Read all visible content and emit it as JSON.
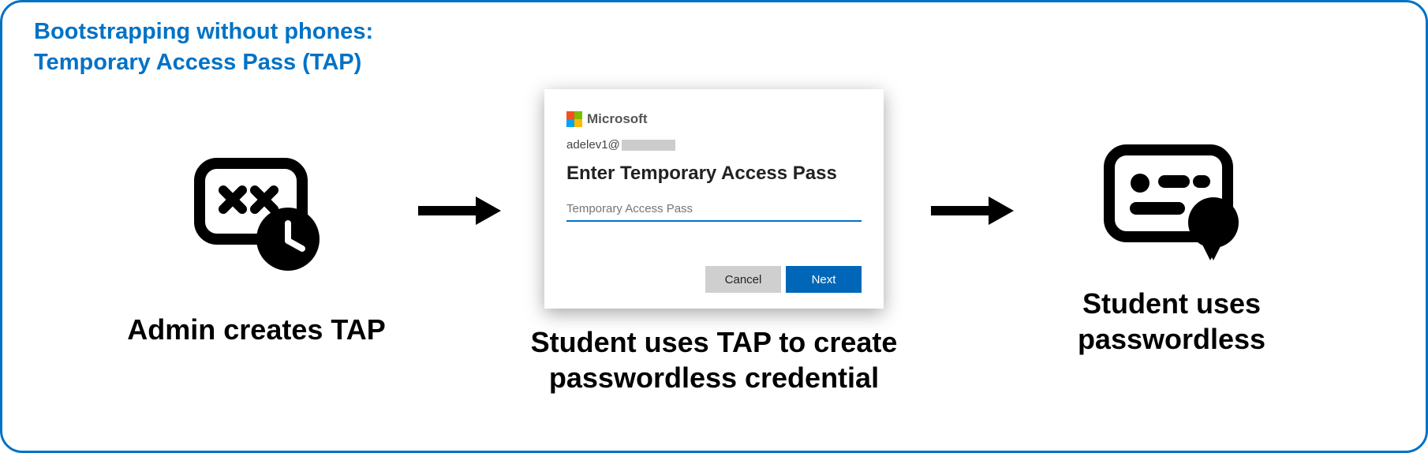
{
  "title_line1": "Bootstrapping without phones:",
  "title_line2": "Temporary Access Pass (TAP)",
  "step1_caption": "Admin creates TAP",
  "step2_caption_line1": "Student uses TAP to create",
  "step2_caption_line2": "passwordless credential",
  "step3_caption_line1": "Student uses",
  "step3_caption_line2": "passwordless",
  "dialog": {
    "brand": "Microsoft",
    "user_prefix": "adelev1@",
    "heading": "Enter Temporary Access Pass",
    "placeholder": "Temporary Access Pass",
    "cancel": "Cancel",
    "next": "Next"
  }
}
